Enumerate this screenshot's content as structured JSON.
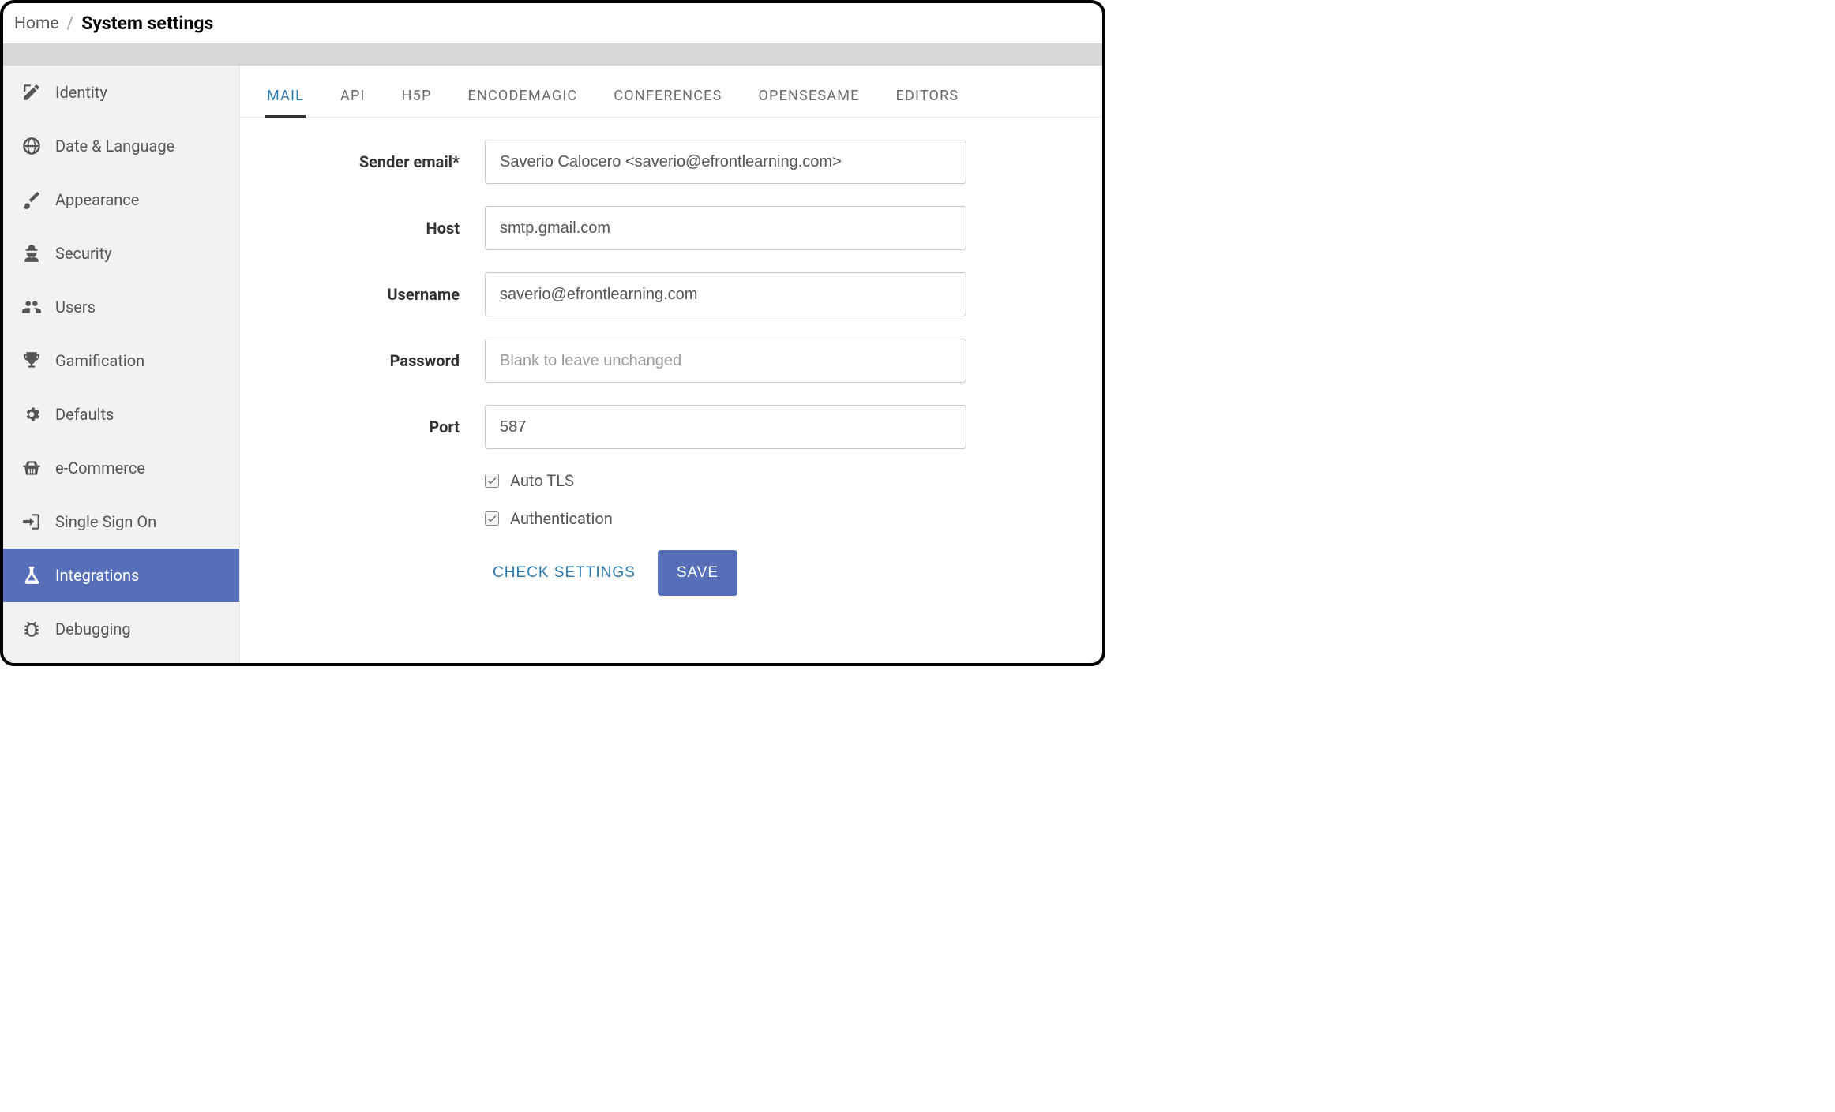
{
  "breadcrumb": {
    "home": "Home",
    "current": "System settings"
  },
  "sidebar": {
    "items": [
      {
        "label": "Identity",
        "icon": "pencil-square-icon"
      },
      {
        "label": "Date & Language",
        "icon": "globe-icon"
      },
      {
        "label": "Appearance",
        "icon": "paintbrush-icon"
      },
      {
        "label": "Security",
        "icon": "agent-icon"
      },
      {
        "label": "Users",
        "icon": "users-icon"
      },
      {
        "label": "Gamification",
        "icon": "trophy-icon"
      },
      {
        "label": "Defaults",
        "icon": "gears-icon"
      },
      {
        "label": "e-Commerce",
        "icon": "basket-icon"
      },
      {
        "label": "Single Sign On",
        "icon": "signin-icon"
      },
      {
        "label": "Integrations",
        "icon": "flask-icon"
      },
      {
        "label": "Debugging",
        "icon": "bug-icon"
      }
    ],
    "active_index": 9
  },
  "tabs": {
    "items": [
      {
        "label": "MAIL"
      },
      {
        "label": "API"
      },
      {
        "label": "H5P"
      },
      {
        "label": "ENCODEMAGIC"
      },
      {
        "label": "CONFERENCES"
      },
      {
        "label": "OPENSESAME"
      },
      {
        "label": "EDITORS"
      }
    ],
    "active_index": 0
  },
  "form": {
    "sender_email": {
      "label": "Sender email*",
      "value": "Saverio Calocero <saverio@efrontlearning.com>"
    },
    "host": {
      "label": "Host",
      "value": "smtp.gmail.com"
    },
    "username": {
      "label": "Username",
      "value": "saverio@efrontlearning.com"
    },
    "password": {
      "label": "Password",
      "value": "",
      "placeholder": "Blank to leave unchanged"
    },
    "port": {
      "label": "Port",
      "value": "587"
    },
    "auto_tls": {
      "label": "Auto TLS",
      "checked": true
    },
    "authentication": {
      "label": "Authentication",
      "checked": true
    },
    "check_settings": "CHECK SETTINGS",
    "save": "SAVE"
  }
}
